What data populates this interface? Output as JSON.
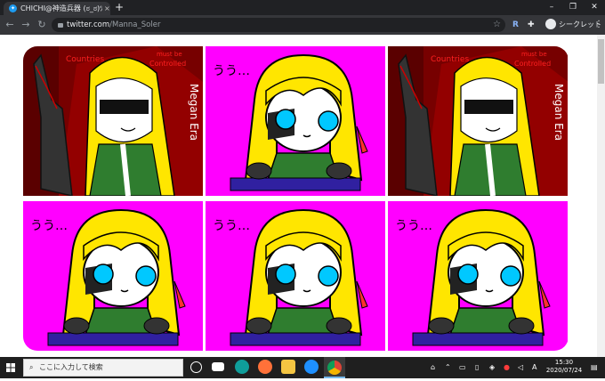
{
  "browser": {
    "tab_title": "CHICHI@神造兵器 (ಠ_ಠ)ﾂﾞﾂﾞﾂﾞ",
    "tab_close": "×",
    "new_tab": "+",
    "url_host": "twitter.com",
    "url_path": "/Manna_Soler",
    "profile_label": "シークレット"
  },
  "tiles": [
    {
      "kind": "poster",
      "text_left": "Countries",
      "text_right_1": "must be",
      "text_right_2": "Controlled",
      "side_text": "Megan Era"
    },
    {
      "kind": "chibi",
      "caption": "うう…"
    },
    {
      "kind": "poster",
      "text_left": "Countries",
      "text_right_1": "must be",
      "text_right_2": "Controlled",
      "side_text": "Megan Era"
    },
    {
      "kind": "chibi",
      "caption": "うう…"
    },
    {
      "kind": "chibi",
      "caption": "うう…"
    },
    {
      "kind": "chibi",
      "caption": "うう…"
    }
  ],
  "taskbar": {
    "search_placeholder": "ここに入力して検索",
    "time": "15:30",
    "date": "2020/07/24",
    "ime": "A"
  },
  "colors": {
    "magenta": "#ff00ff",
    "hair": "#ffe600",
    "coat": "#2f7d2f",
    "poster_bg": "#7a0000"
  }
}
